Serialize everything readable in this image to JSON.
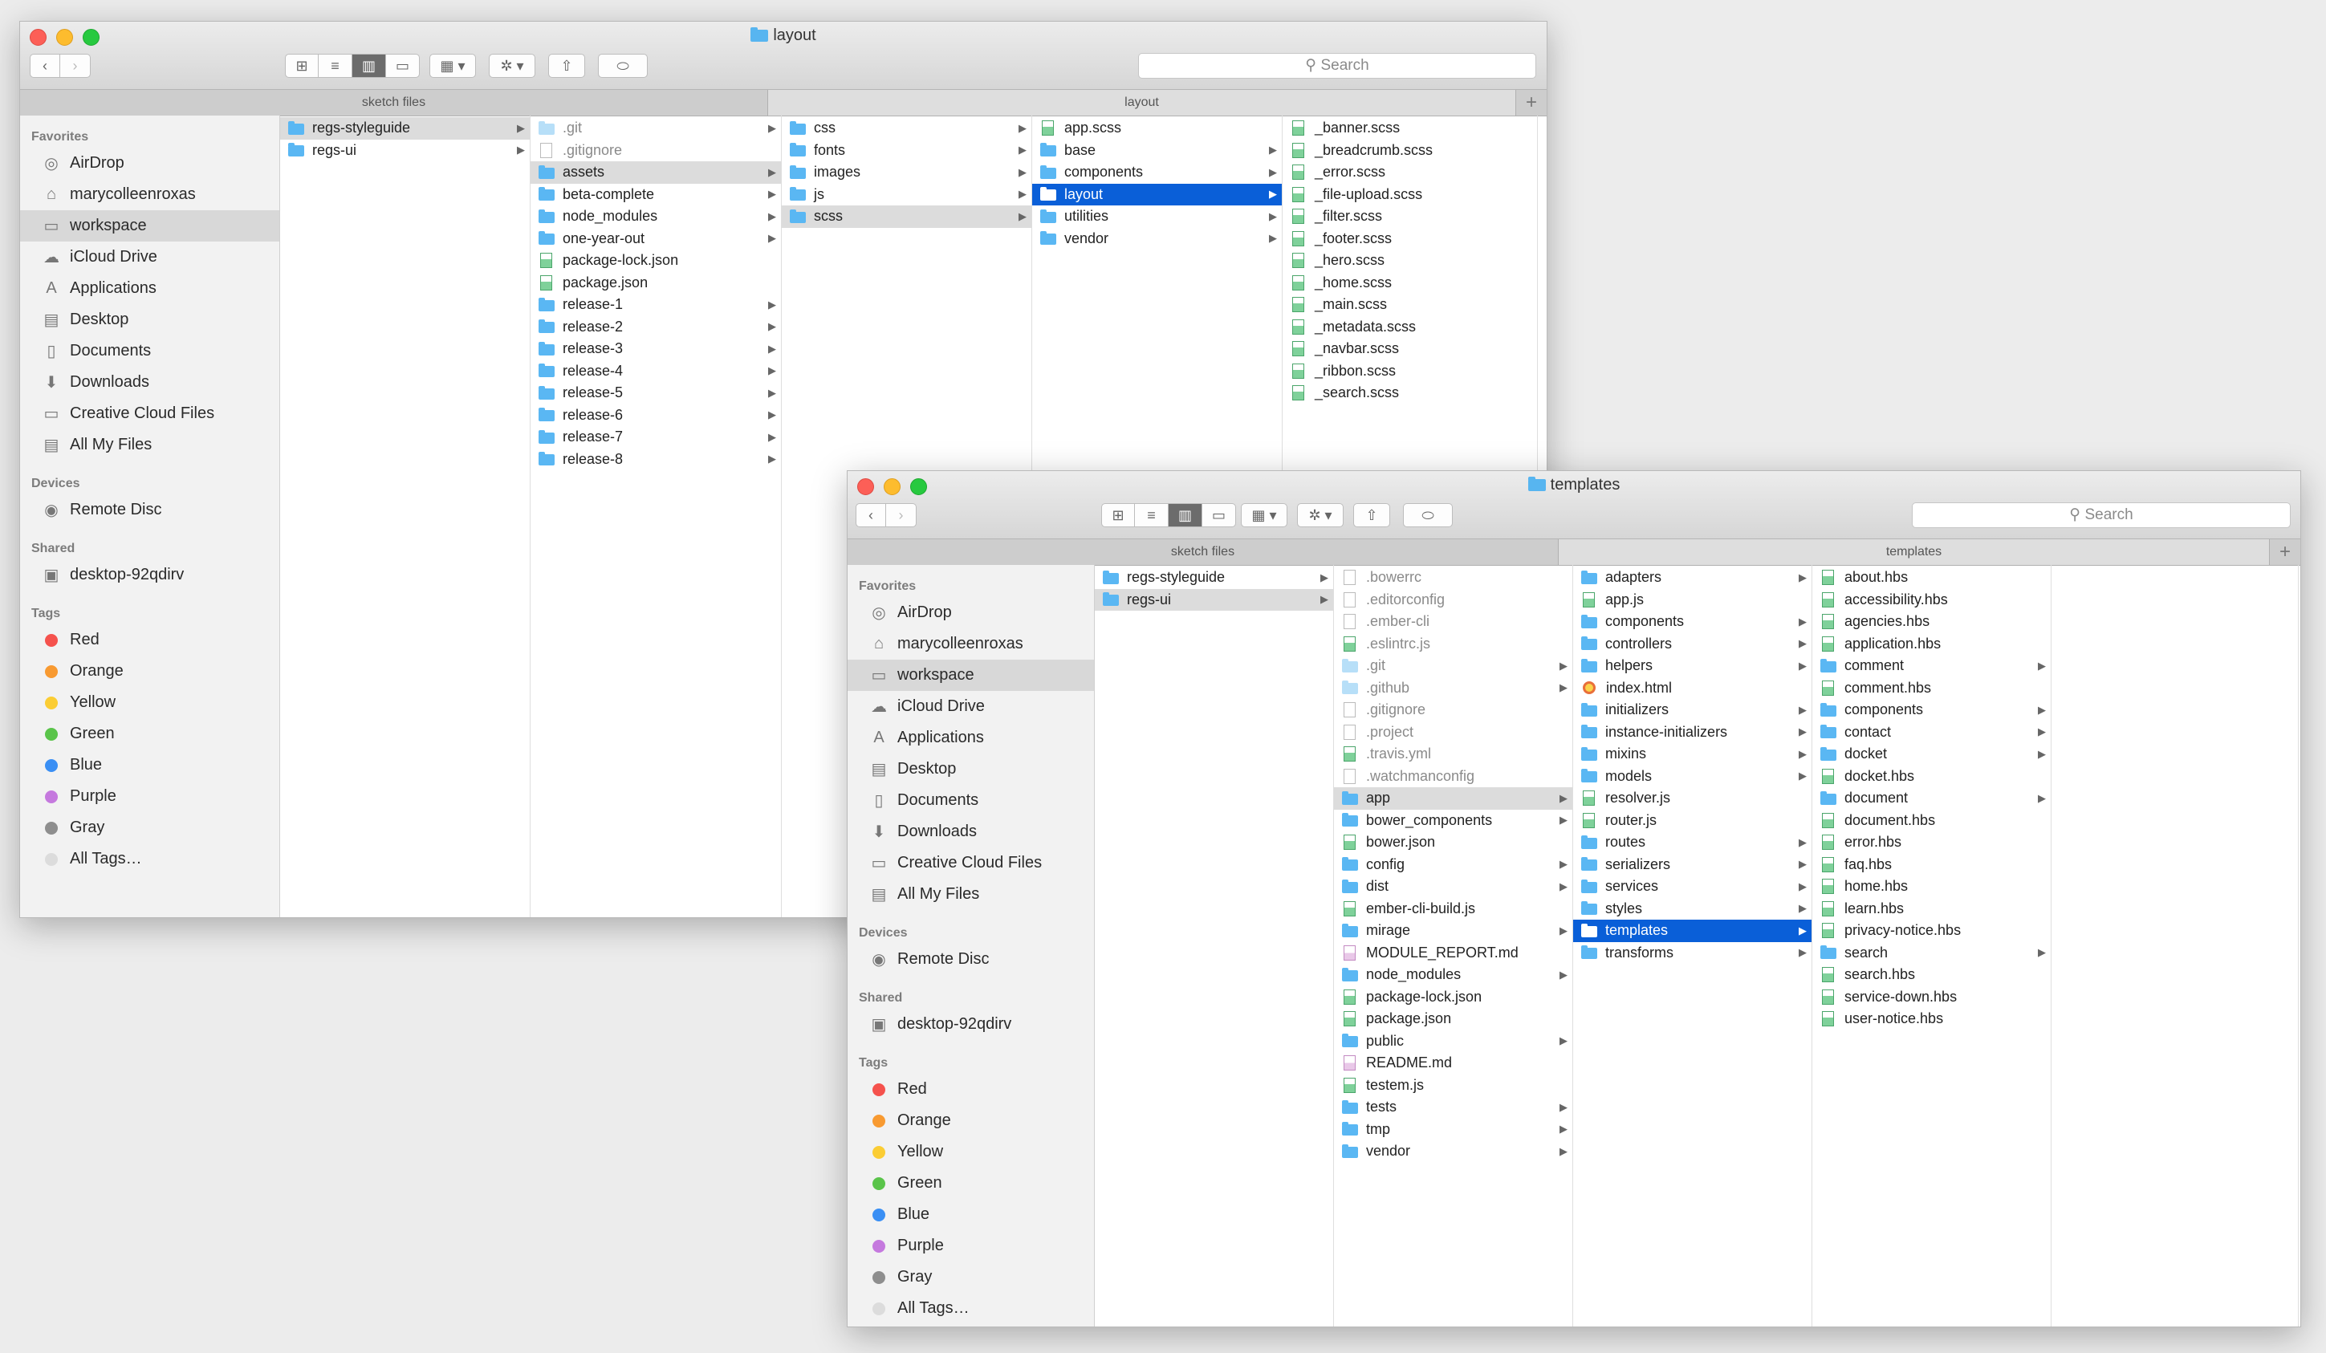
{
  "sidebar": {
    "favorites_header": "Favorites",
    "favorites": [
      {
        "label": "AirDrop",
        "icon": "airdrop-icon",
        "glyph": "◎"
      },
      {
        "label": "marycolleenroxas",
        "icon": "home-icon",
        "glyph": "⌂"
      },
      {
        "label": "workspace",
        "icon": "folder-icon",
        "glyph": "▭"
      },
      {
        "label": "iCloud Drive",
        "icon": "cloud-icon",
        "glyph": "☁"
      },
      {
        "label": "Applications",
        "icon": "applications-icon",
        "glyph": "A"
      },
      {
        "label": "Desktop",
        "icon": "desktop-icon",
        "glyph": "▤"
      },
      {
        "label": "Documents",
        "icon": "documents-icon",
        "glyph": "▯"
      },
      {
        "label": "Downloads",
        "icon": "downloads-icon",
        "glyph": "⬇"
      },
      {
        "label": "Creative Cloud Files",
        "icon": "creative-cloud-icon",
        "glyph": "▭"
      },
      {
        "label": "All My Files",
        "icon": "all-files-icon",
        "glyph": "▤"
      }
    ],
    "devices_header": "Devices",
    "devices": [
      {
        "label": "Remote Disc",
        "icon": "disc-icon",
        "glyph": "◉"
      }
    ],
    "shared_header": "Shared",
    "shared": [
      {
        "label": "desktop-92qdirv",
        "icon": "computer-icon",
        "glyph": "▣"
      }
    ],
    "tags_header": "Tags",
    "tags": [
      {
        "label": "Red",
        "color": "#f5524d"
      },
      {
        "label": "Orange",
        "color": "#f89a31"
      },
      {
        "label": "Yellow",
        "color": "#fbcd34"
      },
      {
        "label": "Green",
        "color": "#5ac44a"
      },
      {
        "label": "Blue",
        "color": "#3a8ff4"
      },
      {
        "label": "Purple",
        "color": "#c579de"
      },
      {
        "label": "Gray",
        "color": "#8e8e8e"
      },
      {
        "label": "All Tags…",
        "color": "#dcdcdc"
      }
    ],
    "selected": "workspace"
  },
  "toolbar": {
    "back": "‹",
    "forward": "›",
    "view_icons": "⊞",
    "view_list": "≡",
    "view_columns": "▥",
    "view_gallery": "▭",
    "arrange": "▦ ▾",
    "action": "✲ ▾",
    "share": "⇧",
    "tag": "⬭",
    "search_placeholder": "Search",
    "search_glyph": "⚲"
  },
  "window1": {
    "title": "layout",
    "tabs": [
      "sketch files",
      "layout"
    ],
    "tab_plus": "+",
    "columns": [
      [
        {
          "name": "regs-styleguide",
          "type": "folder",
          "state": "path",
          "arrow": true
        },
        {
          "name": "regs-ui",
          "type": "folder",
          "arrow": true
        }
      ],
      [
        {
          "name": ".git",
          "type": "folder",
          "dim": true,
          "arrow": true
        },
        {
          "name": ".gitignore",
          "type": "file",
          "dim": true
        },
        {
          "name": "assets",
          "type": "folder",
          "state": "path",
          "arrow": true
        },
        {
          "name": "beta-complete",
          "type": "folder",
          "arrow": true
        },
        {
          "name": "node_modules",
          "type": "folder",
          "arrow": true
        },
        {
          "name": "one-year-out",
          "type": "folder",
          "arrow": true
        },
        {
          "name": "package-lock.json",
          "type": "code"
        },
        {
          "name": "package.json",
          "type": "code"
        },
        {
          "name": "release-1",
          "type": "folder",
          "arrow": true
        },
        {
          "name": "release-2",
          "type": "folder",
          "arrow": true
        },
        {
          "name": "release-3",
          "type": "folder",
          "arrow": true
        },
        {
          "name": "release-4",
          "type": "folder",
          "arrow": true
        },
        {
          "name": "release-5",
          "type": "folder",
          "arrow": true
        },
        {
          "name": "release-6",
          "type": "folder",
          "arrow": true
        },
        {
          "name": "release-7",
          "type": "folder",
          "arrow": true
        },
        {
          "name": "release-8",
          "type": "folder",
          "arrow": true
        }
      ],
      [
        {
          "name": "css",
          "type": "folder",
          "arrow": true
        },
        {
          "name": "fonts",
          "type": "folder",
          "arrow": true
        },
        {
          "name": "images",
          "type": "folder",
          "arrow": true
        },
        {
          "name": "js",
          "type": "folder",
          "arrow": true
        },
        {
          "name": "scss",
          "type": "folder",
          "state": "path",
          "arrow": true
        }
      ],
      [
        {
          "name": "app.scss",
          "type": "code"
        },
        {
          "name": "base",
          "type": "folder",
          "arrow": true
        },
        {
          "name": "components",
          "type": "folder",
          "arrow": true
        },
        {
          "name": "layout",
          "type": "folder",
          "state": "active",
          "arrow": true
        },
        {
          "name": "utilities",
          "type": "folder",
          "arrow": true
        },
        {
          "name": "vendor",
          "type": "folder",
          "arrow": true
        }
      ],
      [
        {
          "name": "_banner.scss",
          "type": "code"
        },
        {
          "name": "_breadcrumb.scss",
          "type": "code"
        },
        {
          "name": "_error.scss",
          "type": "code"
        },
        {
          "name": "_file-upload.scss",
          "type": "code"
        },
        {
          "name": "_filter.scss",
          "type": "code"
        },
        {
          "name": "_footer.scss",
          "type": "code"
        },
        {
          "name": "_hero.scss",
          "type": "code"
        },
        {
          "name": "_home.scss",
          "type": "code"
        },
        {
          "name": "_main.scss",
          "type": "code"
        },
        {
          "name": "_metadata.scss",
          "type": "code"
        },
        {
          "name": "_navbar.scss",
          "type": "code"
        },
        {
          "name": "_ribbon.scss",
          "type": "code"
        },
        {
          "name": "_search.scss",
          "type": "code"
        }
      ]
    ]
  },
  "window2": {
    "title": "templates",
    "tabs": [
      "sketch files",
      "templates"
    ],
    "tab_plus": "+",
    "columns": [
      [
        {
          "name": "regs-styleguide",
          "type": "folder",
          "arrow": true
        },
        {
          "name": "regs-ui",
          "type": "folder",
          "state": "path",
          "arrow": true
        }
      ],
      [
        {
          "name": ".bowerrc",
          "type": "file",
          "dim": true
        },
        {
          "name": ".editorconfig",
          "type": "file",
          "dim": true
        },
        {
          "name": ".ember-cli",
          "type": "file",
          "dim": true
        },
        {
          "name": ".eslintrc.js",
          "type": "code",
          "dim": true
        },
        {
          "name": ".git",
          "type": "folder",
          "dim": true,
          "arrow": true
        },
        {
          "name": ".github",
          "type": "folder",
          "dim": true,
          "arrow": true
        },
        {
          "name": ".gitignore",
          "type": "file",
          "dim": true
        },
        {
          "name": ".project",
          "type": "file",
          "dim": true
        },
        {
          "name": ".travis.yml",
          "type": "code",
          "dim": true
        },
        {
          "name": ".watchmanconfig",
          "type": "file",
          "dim": true
        },
        {
          "name": "app",
          "type": "folder",
          "state": "path",
          "arrow": true
        },
        {
          "name": "bower_components",
          "type": "folder",
          "arrow": true
        },
        {
          "name": "bower.json",
          "type": "code"
        },
        {
          "name": "config",
          "type": "folder",
          "arrow": true
        },
        {
          "name": "dist",
          "type": "folder",
          "arrow": true
        },
        {
          "name": "ember-cli-build.js",
          "type": "code"
        },
        {
          "name": "mirage",
          "type": "folder",
          "arrow": true
        },
        {
          "name": "MODULE_REPORT.md",
          "type": "md"
        },
        {
          "name": "node_modules",
          "type": "folder",
          "arrow": true
        },
        {
          "name": "package-lock.json",
          "type": "code"
        },
        {
          "name": "package.json",
          "type": "code"
        },
        {
          "name": "public",
          "type": "folder",
          "arrow": true
        },
        {
          "name": "README.md",
          "type": "md"
        },
        {
          "name": "testem.js",
          "type": "code"
        },
        {
          "name": "tests",
          "type": "folder",
          "arrow": true
        },
        {
          "name": "tmp",
          "type": "folder",
          "arrow": true
        },
        {
          "name": "vendor",
          "type": "folder",
          "arrow": true
        }
      ],
      [
        {
          "name": "adapters",
          "type": "folder",
          "arrow": true
        },
        {
          "name": "app.js",
          "type": "code"
        },
        {
          "name": "components",
          "type": "folder",
          "arrow": true
        },
        {
          "name": "controllers",
          "type": "folder",
          "arrow": true
        },
        {
          "name": "helpers",
          "type": "folder",
          "arrow": true
        },
        {
          "name": "index.html",
          "type": "html"
        },
        {
          "name": "initializers",
          "type": "folder",
          "arrow": true
        },
        {
          "name": "instance-initializers",
          "type": "folder",
          "arrow": true
        },
        {
          "name": "mixins",
          "type": "folder",
          "arrow": true
        },
        {
          "name": "models",
          "type": "folder",
          "arrow": true
        },
        {
          "name": "resolver.js",
          "type": "code"
        },
        {
          "name": "router.js",
          "type": "code"
        },
        {
          "name": "routes",
          "type": "folder",
          "arrow": true
        },
        {
          "name": "serializers",
          "type": "folder",
          "arrow": true
        },
        {
          "name": "services",
          "type": "folder",
          "arrow": true
        },
        {
          "name": "styles",
          "type": "folder",
          "arrow": true
        },
        {
          "name": "templates",
          "type": "folder",
          "state": "active",
          "arrow": true
        },
        {
          "name": "transforms",
          "type": "folder",
          "arrow": true
        }
      ],
      [
        {
          "name": "about.hbs",
          "type": "code"
        },
        {
          "name": "accessibility.hbs",
          "type": "code"
        },
        {
          "name": "agencies.hbs",
          "type": "code"
        },
        {
          "name": "application.hbs",
          "type": "code"
        },
        {
          "name": "comment",
          "type": "folder",
          "arrow": true
        },
        {
          "name": "comment.hbs",
          "type": "code"
        },
        {
          "name": "components",
          "type": "folder",
          "arrow": true
        },
        {
          "name": "contact",
          "type": "folder",
          "arrow": true
        },
        {
          "name": "docket",
          "type": "folder",
          "arrow": true
        },
        {
          "name": "docket.hbs",
          "type": "code"
        },
        {
          "name": "document",
          "type": "folder",
          "arrow": true
        },
        {
          "name": "document.hbs",
          "type": "code"
        },
        {
          "name": "error.hbs",
          "type": "code"
        },
        {
          "name": "faq.hbs",
          "type": "code"
        },
        {
          "name": "home.hbs",
          "type": "code"
        },
        {
          "name": "learn.hbs",
          "type": "code"
        },
        {
          "name": "privacy-notice.hbs",
          "type": "code"
        },
        {
          "name": "search",
          "type": "folder",
          "arrow": true
        },
        {
          "name": "search.hbs",
          "type": "code"
        },
        {
          "name": "service-down.hbs",
          "type": "code"
        },
        {
          "name": "user-notice.hbs",
          "type": "code"
        }
      ],
      []
    ]
  }
}
